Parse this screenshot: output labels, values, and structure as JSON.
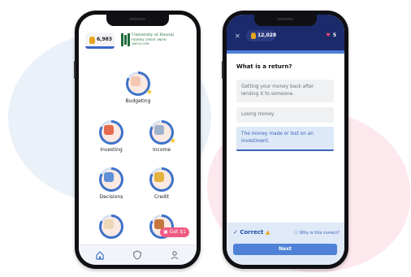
{
  "left_phone": {
    "coin_count": "6,983",
    "logo": {
      "line1": "University of Hawaii",
      "line2": "FEDERAL CREDIT UNION",
      "line3": "UHFCU.COM"
    },
    "nodes": [
      {
        "label": "Budgeting",
        "icon": "piggy-bank-icon",
        "art_color": "#f3c7b2",
        "starred": true
      },
      {
        "label": "Investing",
        "icon": "treasure-chest-icon",
        "art_color": "#e66a4e",
        "starred": false
      },
      {
        "label": "Income",
        "icon": "elephant-icon",
        "art_color": "#9fb2cc",
        "starred": true
      },
      {
        "label": "Decisions",
        "icon": "bird-icon",
        "art_color": "#5f8fd9",
        "starred": false
      },
      {
        "label": "Credit",
        "icon": "building-icon",
        "art_color": "#e3b23c",
        "starred": false
      },
      {
        "label": "",
        "icon": "chicken-icon",
        "art_color": "#ecd8b8",
        "starred": false
      },
      {
        "label": "",
        "icon": "house-icon",
        "art_color": "#c7763c",
        "starred": false
      }
    ],
    "get_badge": "Get $1",
    "tabs": [
      {
        "icon": "home-icon"
      },
      {
        "icon": "shield-icon"
      },
      {
        "icon": "profile-icon"
      }
    ]
  },
  "right_phone": {
    "coin_count": "12,028",
    "hearts": "5",
    "question": "What is a return?",
    "options": [
      {
        "text": "Getting your money back after lending it to someone.",
        "selected": false
      },
      {
        "text": "Losing money.",
        "selected": false
      },
      {
        "text": "The money made or lost on an investment.",
        "selected": true
      }
    ],
    "feedback": "Correct",
    "why_link": "Why is this correct?",
    "next_label": "Next"
  },
  "colors": {
    "accent_blue": "#3d72c9",
    "header_navy": "#1a2a6b",
    "brand_green": "#1f6b3a",
    "badge_pink": "#ef5a82"
  }
}
